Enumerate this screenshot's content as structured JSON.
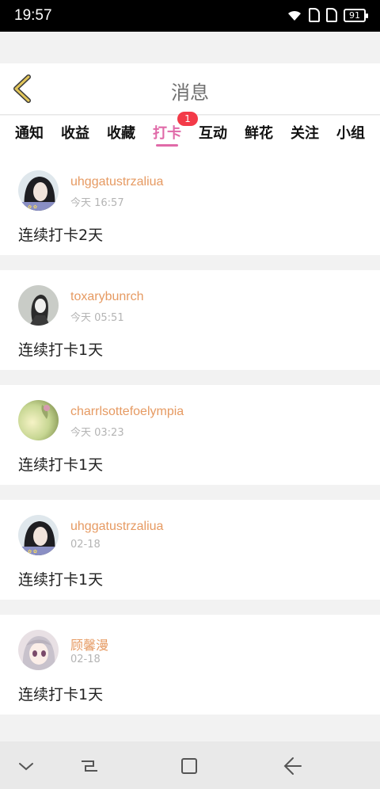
{
  "status": {
    "time": "19:57",
    "battery": "91"
  },
  "header": {
    "title": "消息"
  },
  "tabs": [
    {
      "label": "通知",
      "active": false
    },
    {
      "label": "收益",
      "active": false
    },
    {
      "label": "收藏",
      "active": false
    },
    {
      "label": "打卡",
      "active": true,
      "badge": "1"
    },
    {
      "label": "互动",
      "active": false
    },
    {
      "label": "鲜花",
      "active": false
    },
    {
      "label": "关注",
      "active": false
    },
    {
      "label": "小组",
      "active": false
    }
  ],
  "messages": [
    {
      "name": "uhggatustrzaliua",
      "time": "今天 16:57",
      "text": "连续打卡2天"
    },
    {
      "name": "toxarybunrch",
      "time": "今天 05:51",
      "text": "连续打卡1天"
    },
    {
      "name": "charrlsottefoelympia",
      "time": "今天 03:23",
      "text": "连续打卡1天"
    },
    {
      "name": "uhggatustrzaliua",
      "time": "02-18",
      "text": "连续打卡1天"
    },
    {
      "name": "顾馨漫",
      "time": "02-18",
      "text": "连续打卡1天"
    }
  ],
  "colors": {
    "accent": "#e06aa8",
    "username": "#e69a62",
    "badge": "#f33a48",
    "back_arrow": "#e2c65a"
  },
  "icons": {
    "back": "chevron-left-icon",
    "wifi": "wifi-icon",
    "battery": "battery-icon"
  }
}
